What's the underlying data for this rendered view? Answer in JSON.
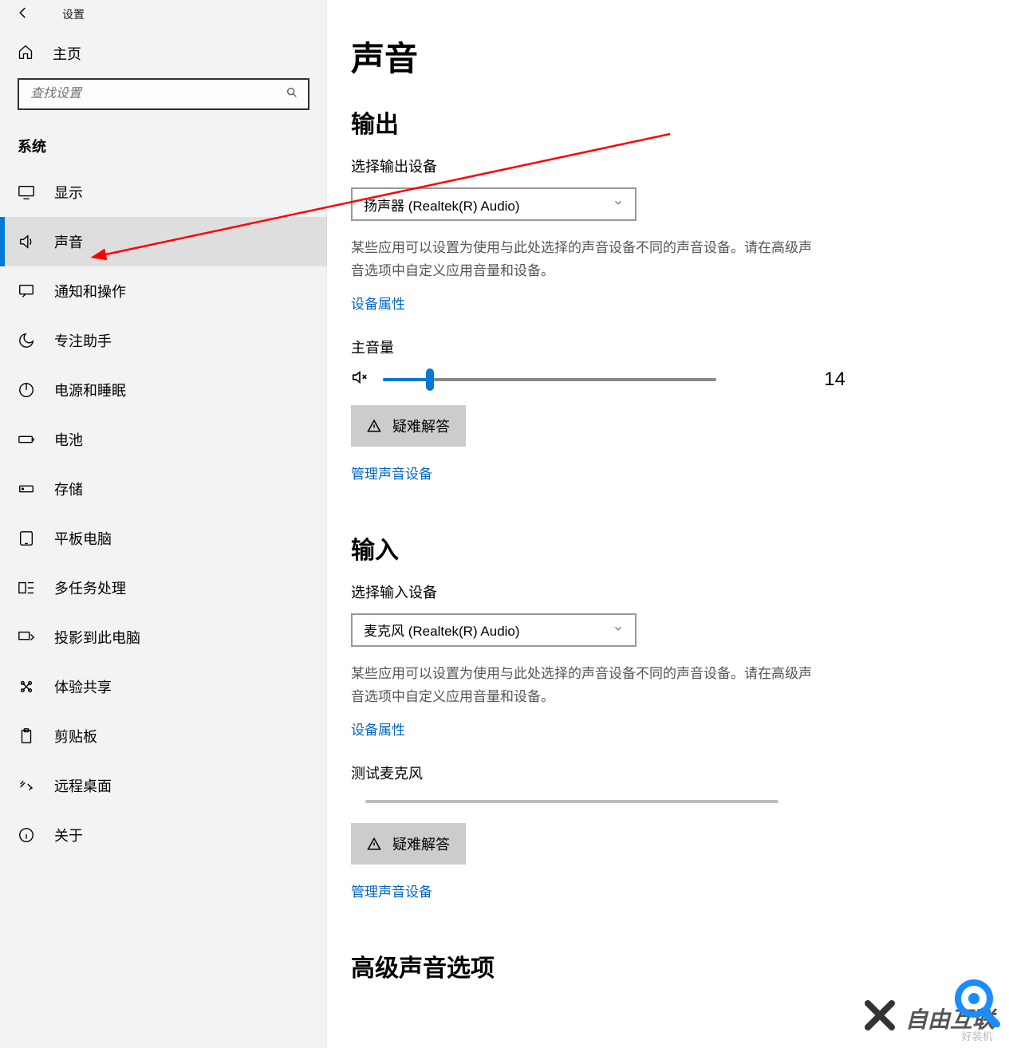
{
  "titlebar": {
    "app_title": "设置"
  },
  "sidebar": {
    "home_label": "主页",
    "search_placeholder": "查找设置",
    "section_label": "系统",
    "items": [
      {
        "id": "display",
        "label": "显示",
        "icon": "monitor"
      },
      {
        "id": "sound",
        "label": "声音",
        "icon": "speaker",
        "active": true
      },
      {
        "id": "notifications",
        "label": "通知和操作",
        "icon": "message"
      },
      {
        "id": "focus",
        "label": "专注助手",
        "icon": "moon"
      },
      {
        "id": "power",
        "label": "电源和睡眠",
        "icon": "power"
      },
      {
        "id": "battery",
        "label": "电池",
        "icon": "battery"
      },
      {
        "id": "storage",
        "label": "存储",
        "icon": "storage"
      },
      {
        "id": "tablet",
        "label": "平板电脑",
        "icon": "tablet"
      },
      {
        "id": "multitask",
        "label": "多任务处理",
        "icon": "multitask"
      },
      {
        "id": "project",
        "label": "投影到此电脑",
        "icon": "project"
      },
      {
        "id": "shared",
        "label": "体验共享",
        "icon": "shared"
      },
      {
        "id": "clipboard",
        "label": "剪贴板",
        "icon": "clipboard"
      },
      {
        "id": "remote",
        "label": "远程桌面",
        "icon": "remote"
      },
      {
        "id": "about",
        "label": "关于",
        "icon": "about"
      }
    ]
  },
  "page": {
    "title": "声音",
    "output": {
      "heading": "输出",
      "device_label": "选择输出设备",
      "device_value": "扬声器 (Realtek(R) Audio)",
      "note": "某些应用可以设置为使用与此处选择的声音设备不同的声音设备。请在高级声音选项中自定义应用音量和设备。",
      "device_props_link": "设备属性",
      "master_label": "主音量",
      "volume_value": "14",
      "volume_percent": 14,
      "troubleshoot_btn": "疑难解答",
      "manage_link": "管理声音设备"
    },
    "input": {
      "heading": "输入",
      "device_label": "选择输入设备",
      "device_value": "麦克风 (Realtek(R) Audio)",
      "note": "某些应用可以设置为使用与此处选择的声音设备不同的声音设备。请在高级声音选项中自定义应用音量和设备。",
      "device_props_link": "设备属性",
      "test_label": "测试麦克风",
      "troubleshoot_btn": "疑难解答",
      "manage_link": "管理声音设备"
    },
    "advanced_heading": "高级声音选项"
  },
  "watermark": {
    "text1": "自由互联",
    "text2": "好装机"
  },
  "colors": {
    "accent": "#0078d4",
    "link": "#0066c0"
  }
}
